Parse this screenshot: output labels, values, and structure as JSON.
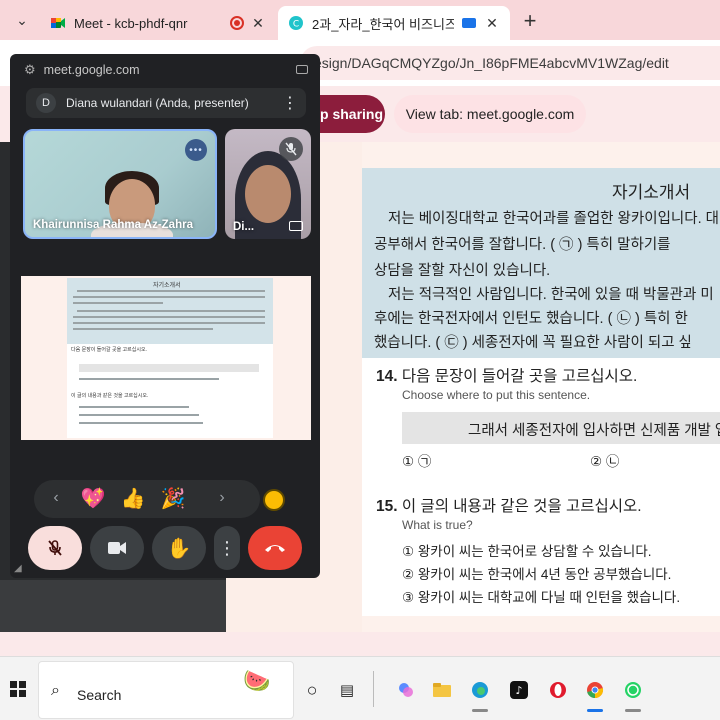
{
  "browser": {
    "tabs": [
      {
        "title": "Meet - kcb-phdf-qnr",
        "close": "✕"
      },
      {
        "title": "2과_자라_한국어 비즈니즈",
        "close": "✕"
      }
    ],
    "new_tab": "+",
    "url": "esign/DAGqCMQYZgo/Jn_I86pFME4abcvMV1WZag/edit"
  },
  "sharing": {
    "stop_label": "p sharing",
    "view_tab_label": "View tab: meet.google.com"
  },
  "meet": {
    "url": "meet.google.com",
    "presenter": {
      "initial": "D",
      "text": "Diana wulandari (Anda, presenter)"
    },
    "participants": [
      {
        "name": "Khairunnisa Rahma Az-Zahra"
      },
      {
        "name": "Di..."
      }
    ],
    "reactions": [
      "💖",
      "👍",
      "🎉"
    ],
    "controls": [
      "mic-off",
      "camera",
      "raise-hand",
      "more",
      "end-call"
    ]
  },
  "document": {
    "title": "자기소개서",
    "paragraph": [
      "저는 베이징대학교 한국어과를 졸업한 왕카이입니다. 대",
      "공부해서 한국어를 잘합니다. (   ㉠   ) 특히 말하기를",
      "상담을 잘할 자신이 있습니다.",
      "저는 적극적인 사람입니다. 한국에 있을 때 박물관과 미",
      "후에는 한국전자에서 인턴도 했습니다. (   ㉡   ) 특히 한",
      "했습니다. (   ㉢   ) 세종전자에 꼭 필요한 사람이 되고 싶"
    ],
    "q14": {
      "number": "14.",
      "question": "다음 문장이 들어갈 곳을 고르십시오.",
      "subtitle": "Choose where to put this sentence.",
      "sentence": "그래서 세종전자에 입사하면 신제품 개발 업무",
      "options": [
        "① ㉠",
        "② ㉡"
      ]
    },
    "q15": {
      "number": "15.",
      "question": "이 글의 내용과 같은 것을 고르십시오.",
      "subtitle": "What is true?",
      "options": [
        "① 왕카이 씨는 한국어로 상담할 수 있습니다.",
        "② 왕카이 씨는 한국에서 4년 동안 공부했습니다.",
        "③ 왕카이 씨는 대학교에 다닐 때 인턴을 했습니다."
      ]
    }
  },
  "taskbar": {
    "search_label": "Search"
  },
  "colors": {
    "accent_blue": "#8ab4f8",
    "end_call_red": "#ea4335",
    "stop_sharing": "#8c1d3c",
    "doc_header": "#cfe0e7"
  }
}
